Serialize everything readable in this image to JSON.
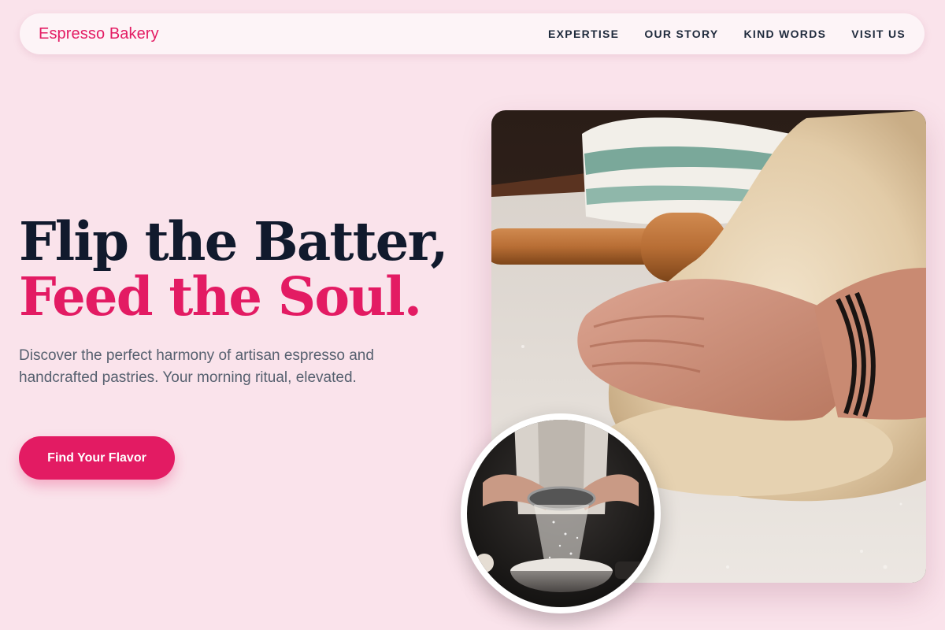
{
  "brand": {
    "name": "Espresso Bakery"
  },
  "nav": {
    "items": [
      {
        "label": "EXPERTISE"
      },
      {
        "label": "OUR STORY"
      },
      {
        "label": "KIND WORDS"
      },
      {
        "label": "VISIT US"
      }
    ]
  },
  "hero": {
    "title_line1": "Flip the Batter,",
    "title_line2": "Feed the Soul.",
    "description": "Discover the perfect harmony of artisan espresso and handcrafted pastries. Your morning ritual, elevated.",
    "cta_label": "Find Your Flavor"
  },
  "images": {
    "main": "hands-kneading-dough-photo",
    "inset": "sifting-flour-into-bowl-photo"
  },
  "colors": {
    "accent": "#e31b63",
    "background": "#fae3eb",
    "heading": "#111a2d",
    "body_text": "#56606f"
  }
}
